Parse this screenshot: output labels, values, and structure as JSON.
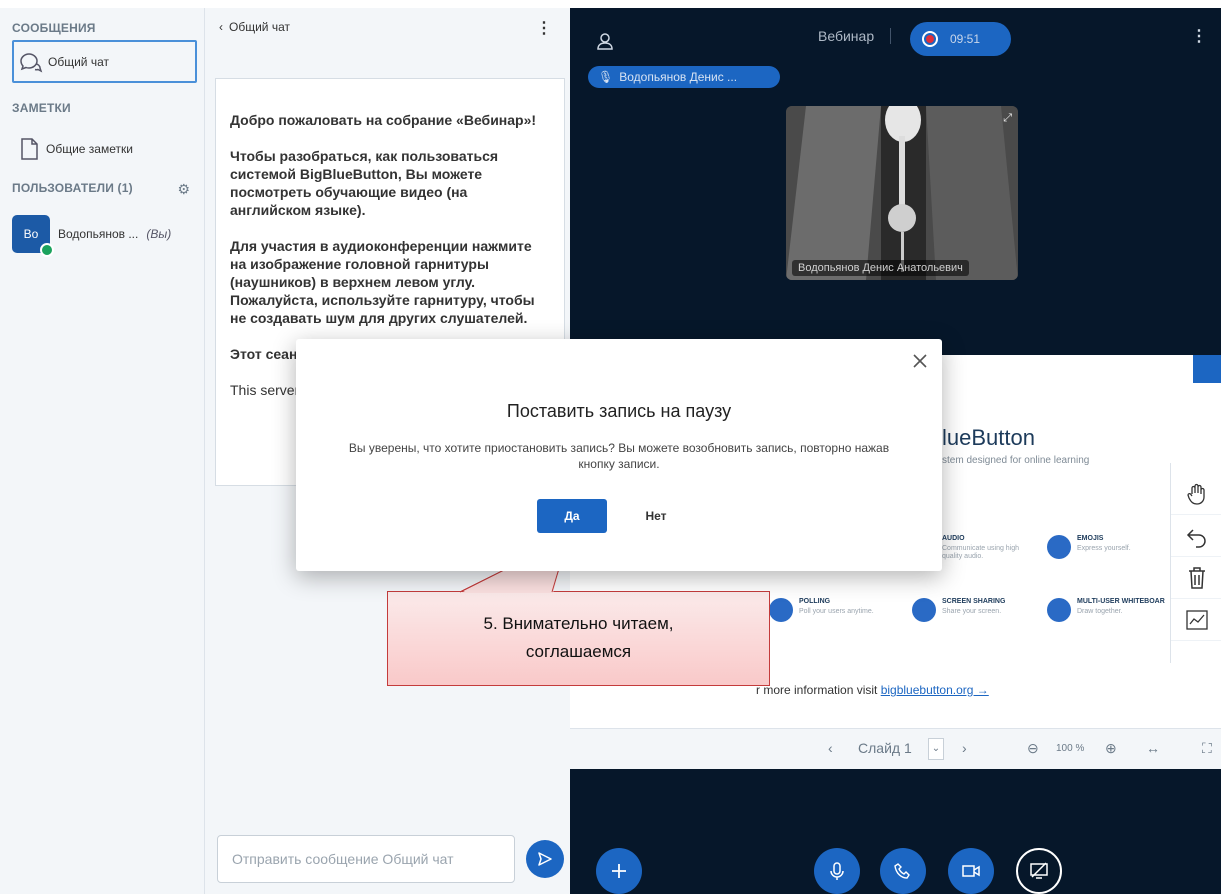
{
  "sidebar": {
    "messages_header": "СООБЩЕНИЯ",
    "public_chat": "Общий чат",
    "notes_header": "ЗАМЕТКИ",
    "shared_notes": "Общие заметки",
    "users_header": "ПОЛЬЗОВАТЕЛИ (1)",
    "user_avatar_initials": "Bo",
    "user_name": "Водопьянов ...",
    "user_you": "(Вы)"
  },
  "chat": {
    "back_label": "Общий чат",
    "welcome": {
      "p1": "Добро пожаловать на собрание «Вебинар»!",
      "p2": "Чтобы разобраться, как пользоваться системой BigBlueButton, Вы можете посмотреть обучающие видео (на английском языке).",
      "p3": "Для участия в аудиоконференции нажмите на изображение головной гарнитуры (наушников) в верхнем левом углу. Пожалуйста, используйте гарнитуру, чтобы не создавать шум для других слушателей.",
      "p4": "Этот сеанс может быть записан.",
      "p5": "This server is running BigBlueButton."
    },
    "input_placeholder": "Отправить сообщение Общий чат"
  },
  "main": {
    "title": "Вебинар",
    "rec_time": "09:51",
    "speaker": "Водопьянов Денис ...",
    "video_name": "Водопьянов Денис Анатольевич",
    "presentation": {
      "title": "lueButton",
      "subtitle": "stem designed for online learning",
      "features": [
        {
          "title": "AUDIO",
          "desc1": "Communicate using high",
          "desc2": "quality audio."
        },
        {
          "title": "EMOJIS",
          "desc1": "Express yourself.",
          "desc2": ""
        },
        {
          "title": "POLLING",
          "desc1": "Poll your users anytime.",
          "desc2": ""
        },
        {
          "title": "SCREEN SHARING",
          "desc1": "Share your screen.",
          "desc2": ""
        },
        {
          "title": "MULTI-USER WHITEBOAR",
          "desc1": "Draw together.",
          "desc2": ""
        }
      ],
      "more_info_prefix": "r more information visit ",
      "more_info_link": "bigbluebutton.org →"
    },
    "toolbar": {
      "slide_label": "Слайд 1",
      "zoom": "100 %"
    }
  },
  "modal": {
    "title": "Поставить запись на паузу",
    "text": "Вы уверены, что хотите приостановить запись? Вы можете возобновить запись, повторно нажав кнопку записи.",
    "yes": "Да",
    "no": "Нет"
  },
  "callout": {
    "line1": "5. Внимательно читаем,",
    "line2": "соглашаемся"
  },
  "colors": {
    "accent": "#1c66c2",
    "dark_bg": "#06172a",
    "record_red": "#e0303a",
    "callout_fill": "#f9c9c9",
    "callout_border": "#c43b3b"
  }
}
